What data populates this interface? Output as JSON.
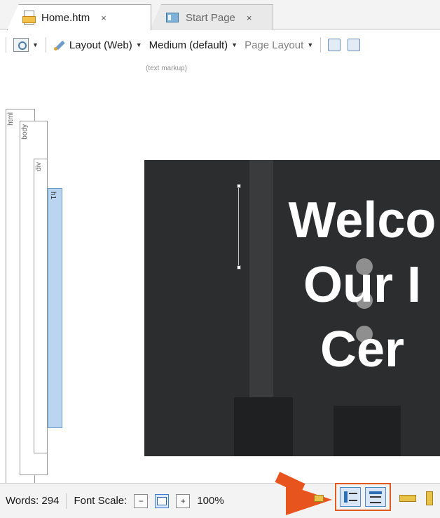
{
  "tabs": [
    {
      "label": "Home.htm",
      "close": "×",
      "active": true
    },
    {
      "label": "Start Page",
      "close": "×",
      "active": false
    }
  ],
  "toolbar": {
    "layout_label": "Layout (Web)",
    "medium_label": "Medium (default)",
    "page_layout_label": "Page Layout",
    "markup_hint": "(text markup)"
  },
  "tag_bars": [
    {
      "label": "html"
    },
    {
      "label": "body"
    },
    {
      "label": "div"
    },
    {
      "label": "h1"
    }
  ],
  "canvas": {
    "heading_text": "Welcome to\nOur Help\nCenter",
    "visible_heading": "Welco\nOur I\nCer"
  },
  "statusbar": {
    "words": "Words: 294",
    "font_scale_label": "Font Scale:",
    "scale_decrease": "−",
    "scale_reset": "100",
    "scale_increase": "+",
    "zoom_value": "100%"
  },
  "colors": {
    "accent_highlight": "#e8541d",
    "h1_tagbar": "#b9d5ef",
    "hero_background": "#2c2d2f"
  }
}
